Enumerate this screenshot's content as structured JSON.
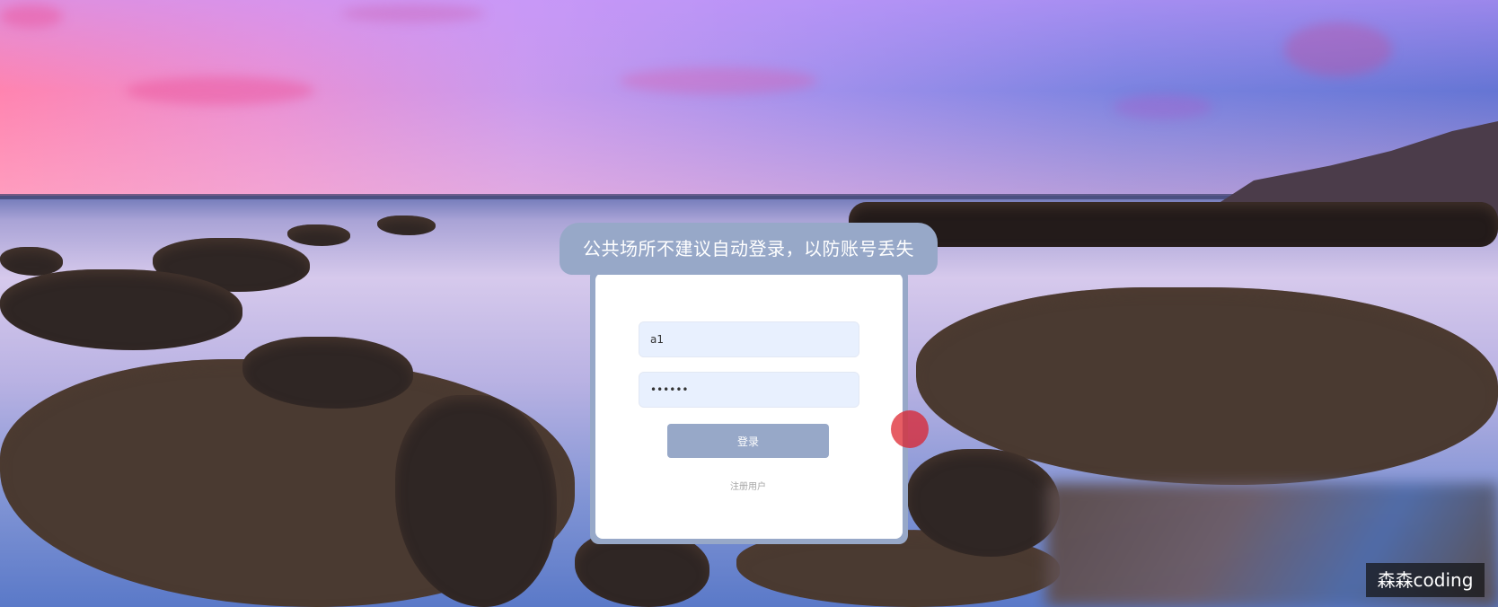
{
  "background": {
    "image": "coastal-sunset-rocks"
  },
  "notice": {
    "text": "公共场所不建议自动登录，以防账号丢失"
  },
  "login_form": {
    "username_value": "a1",
    "password_value": "••••••",
    "login_label": "登录",
    "register_label": "注册用户"
  },
  "colors": {
    "accent": "#97a8c8",
    "input_bg": "#e8f0fe"
  },
  "watermark": {
    "text": "森森coding"
  }
}
